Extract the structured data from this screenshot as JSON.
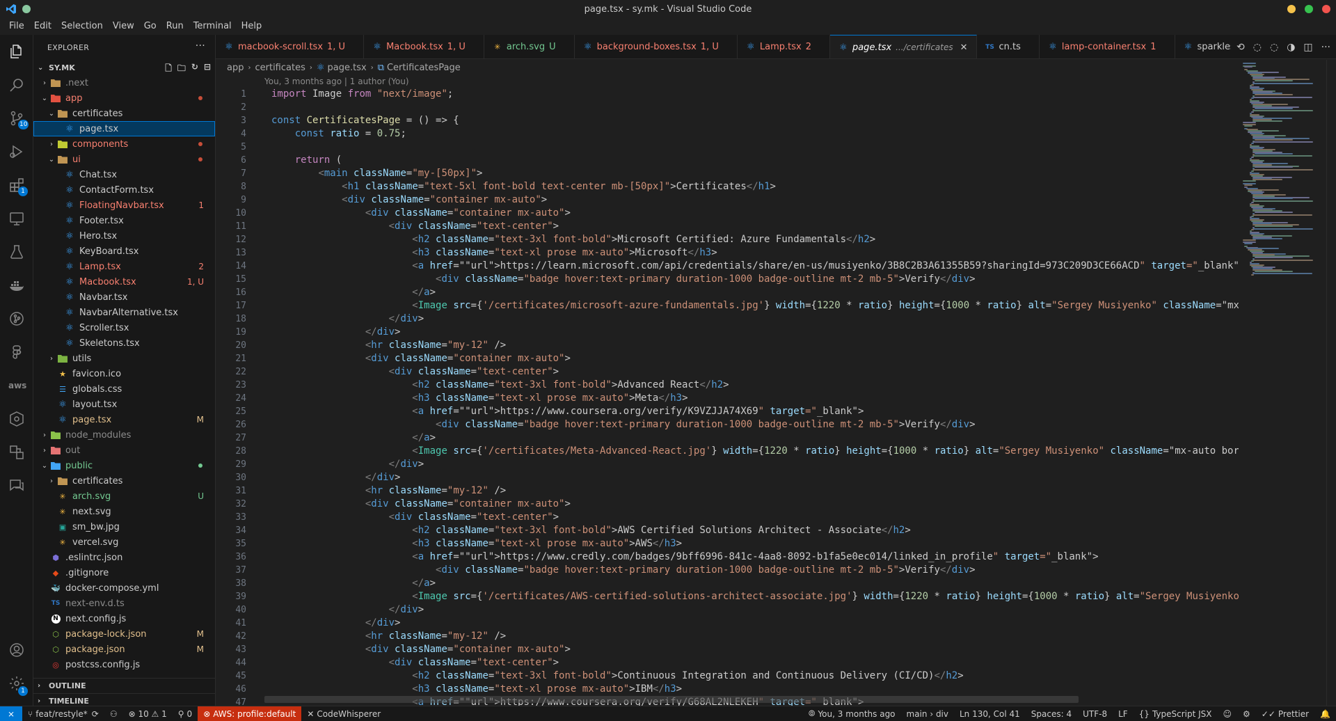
{
  "window": {
    "title": "page.tsx - sy.mk - Visual Studio Code"
  },
  "menu": [
    "File",
    "Edit",
    "Selection",
    "View",
    "Go",
    "Run",
    "Terminal",
    "Help"
  ],
  "activity": {
    "source_control_badge": "10",
    "extensions_badge": "1",
    "settings_badge": "1"
  },
  "explorer": {
    "header": "EXPLORER",
    "more": "···",
    "root": "SY.MK",
    "items": [
      {
        "label": ".next",
        "chev": "›",
        "depth": 1,
        "color": "c-dim",
        "icon": "folder",
        "badge": ""
      },
      {
        "label": "app",
        "chev": "⌄",
        "depth": 1,
        "color": "c-err",
        "icon": "folder-app",
        "badge": "",
        "dot": "#c74e39"
      },
      {
        "label": "certificates",
        "chev": "⌄",
        "depth": 2,
        "color": "c-normal",
        "icon": "folder",
        "badge": ""
      },
      {
        "label": "page.tsx",
        "chev": "",
        "depth": 3,
        "color": "c-normal",
        "icon": "react",
        "badge": "",
        "selected": true
      },
      {
        "label": "components",
        "chev": "›",
        "depth": 2,
        "color": "c-err",
        "icon": "folder-comp",
        "badge": "",
        "dot": "#c74e39"
      },
      {
        "label": "ui",
        "chev": "⌄",
        "depth": 2,
        "color": "c-err",
        "icon": "folder",
        "badge": "",
        "dot": "#c74e39"
      },
      {
        "label": "Chat.tsx",
        "chev": "",
        "depth": 3,
        "color": "c-normal",
        "icon": "react",
        "badge": ""
      },
      {
        "label": "ContactForm.tsx",
        "chev": "",
        "depth": 3,
        "color": "c-normal",
        "icon": "react",
        "badge": ""
      },
      {
        "label": "FloatingNavbar.tsx",
        "chev": "",
        "depth": 3,
        "color": "c-err",
        "icon": "react",
        "badge": "1"
      },
      {
        "label": "Footer.tsx",
        "chev": "",
        "depth": 3,
        "color": "c-normal",
        "icon": "react",
        "badge": ""
      },
      {
        "label": "Hero.tsx",
        "chev": "",
        "depth": 3,
        "color": "c-normal",
        "icon": "react",
        "badge": ""
      },
      {
        "label": "KeyBoard.tsx",
        "chev": "",
        "depth": 3,
        "color": "c-normal",
        "icon": "react",
        "badge": ""
      },
      {
        "label": "Lamp.tsx",
        "chev": "",
        "depth": 3,
        "color": "c-err",
        "icon": "react",
        "badge": "2"
      },
      {
        "label": "Macbook.tsx",
        "chev": "",
        "depth": 3,
        "color": "c-err",
        "icon": "react",
        "badge": "1, U"
      },
      {
        "label": "Navbar.tsx",
        "chev": "",
        "depth": 3,
        "color": "c-normal",
        "icon": "react",
        "badge": ""
      },
      {
        "label": "NavbarAlternative.tsx",
        "chev": "",
        "depth": 3,
        "color": "c-normal",
        "icon": "react",
        "badge": ""
      },
      {
        "label": "Scroller.tsx",
        "chev": "",
        "depth": 3,
        "color": "c-normal",
        "icon": "react",
        "badge": ""
      },
      {
        "label": "Skeletons.tsx",
        "chev": "",
        "depth": 3,
        "color": "c-normal",
        "icon": "react",
        "badge": ""
      },
      {
        "label": "utils",
        "chev": "›",
        "depth": 2,
        "color": "c-normal",
        "icon": "folder-utils",
        "badge": ""
      },
      {
        "label": "favicon.ico",
        "chev": "",
        "depth": 2,
        "color": "c-normal",
        "icon": "star",
        "badge": ""
      },
      {
        "label": "globals.css",
        "chev": "",
        "depth": 2,
        "color": "c-normal",
        "icon": "css",
        "badge": ""
      },
      {
        "label": "layout.tsx",
        "chev": "",
        "depth": 2,
        "color": "c-normal",
        "icon": "react",
        "badge": ""
      },
      {
        "label": "page.tsx",
        "chev": "",
        "depth": 2,
        "color": "c-mod",
        "icon": "react",
        "badge": "M"
      },
      {
        "label": "node_modules",
        "chev": "›",
        "depth": 1,
        "color": "c-dim",
        "icon": "folder-node",
        "badge": ""
      },
      {
        "label": "out",
        "chev": "›",
        "depth": 1,
        "color": "c-dim",
        "icon": "folder-out",
        "badge": ""
      },
      {
        "label": "public",
        "chev": "⌄",
        "depth": 1,
        "color": "c-untr",
        "icon": "folder-public",
        "badge": "",
        "dot": "#73c991"
      },
      {
        "label": "certificates",
        "chev": "›",
        "depth": 2,
        "color": "c-normal",
        "icon": "folder",
        "badge": ""
      },
      {
        "label": "arch.svg",
        "chev": "",
        "depth": 2,
        "color": "c-untr",
        "icon": "svg",
        "badge": "U"
      },
      {
        "label": "next.svg",
        "chev": "",
        "depth": 2,
        "color": "c-normal",
        "icon": "svg",
        "badge": ""
      },
      {
        "label": "sm_bw.jpg",
        "chev": "",
        "depth": 2,
        "color": "c-normal",
        "icon": "image",
        "badge": ""
      },
      {
        "label": "vercel.svg",
        "chev": "",
        "depth": 2,
        "color": "c-normal",
        "icon": "svg",
        "badge": ""
      },
      {
        "label": ".eslintrc.json",
        "chev": "",
        "depth": 1,
        "color": "c-normal",
        "icon": "eslint",
        "badge": ""
      },
      {
        "label": ".gitignore",
        "chev": "",
        "depth": 1,
        "color": "c-normal",
        "icon": "git",
        "badge": ""
      },
      {
        "label": "docker-compose.yml",
        "chev": "",
        "depth": 1,
        "color": "c-normal",
        "icon": "docker",
        "badge": ""
      },
      {
        "label": "next-env.d.ts",
        "chev": "",
        "depth": 1,
        "color": "c-dim",
        "icon": "ts",
        "badge": ""
      },
      {
        "label": "next.config.js",
        "chev": "",
        "depth": 1,
        "color": "c-normal",
        "icon": "next",
        "badge": ""
      },
      {
        "label": "package-lock.json",
        "chev": "",
        "depth": 1,
        "color": "c-mod",
        "icon": "npm",
        "badge": "M"
      },
      {
        "label": "package.json",
        "chev": "",
        "depth": 1,
        "color": "c-mod",
        "icon": "npm",
        "badge": "M"
      },
      {
        "label": "postcss.config.js",
        "chev": "",
        "depth": 1,
        "color": "c-normal",
        "icon": "postcss",
        "badge": ""
      }
    ],
    "outline": "OUTLINE",
    "timeline": "TIMELINE"
  },
  "tabs": [
    {
      "label": "macbook-scroll.tsx",
      "status": "1, U",
      "color": "c-err",
      "icon": "react"
    },
    {
      "label": "Macbook.tsx",
      "status": "1, U",
      "color": "c-err",
      "icon": "react"
    },
    {
      "label": "arch.svg",
      "status": "U",
      "color": "c-untr",
      "icon": "svg"
    },
    {
      "label": "background-boxes.tsx",
      "status": "1, U",
      "color": "c-err",
      "icon": "react"
    },
    {
      "label": "Lamp.tsx",
      "status": "2",
      "color": "c-err",
      "icon": "react"
    },
    {
      "label": "page.tsx",
      "status": "",
      "desc": ".../certificates",
      "color": "c-normal",
      "icon": "react",
      "active": true
    },
    {
      "label": "cn.ts",
      "status": "",
      "color": "c-normal",
      "icon": "ts"
    },
    {
      "label": "lamp-container.tsx",
      "status": "1",
      "color": "c-err",
      "icon": "react"
    },
    {
      "label": "sparkles.tsx",
      "status": "",
      "color": "c-normal",
      "icon": "react"
    }
  ],
  "breadcrumb": [
    "app",
    "certificates",
    "page.tsx",
    "CertificatesPage"
  ],
  "blame": "You, 3 months ago | 1 author (You)",
  "code": [
    "import Image from \"next/image\";",
    "",
    "const CertificatesPage = () => {",
    "    const ratio = 0.75;",
    "",
    "    return (",
    "        <main className=\"my-[50px]\">",
    "            <h1 className=\"text-5xl font-bold text-center mb-[50px]\">Certificates</h1>",
    "            <div className=\"container mx-auto\">",
    "                <div className=\"container mx-auto\">",
    "                    <div className=\"text-center\">",
    "                        <h2 className=\"text-3xl font-bold\">Microsoft Certified: Azure Fundamentals</h2>",
    "                        <h3 className=\"text-xl prose mx-auto\">Microsoft</h3>",
    "                        <a href=\"https://learn.microsoft.com/api/credentials/share/en-us/musiyenko/3B8C2B3A61355B59?sharingId=973C209D3CE66ACD\" target=\"_blank\">",
    "                            <div className=\"badge hover:text-primary duration-1000 badge-outline mt-2 mb-5\">Verify</div>",
    "                        </a>",
    "                        <Image src={'/certificates/microsoft-azure-fundamentals.jpg'} width={1220 * ratio} height={1000 * ratio} alt=\"Sergey Musiyenko\" className=\"mx-au",
    "                    </div>",
    "                </div>",
    "                <hr className=\"my-12\" />",
    "                <div className=\"container mx-auto\">",
    "                    <div className=\"text-center\">",
    "                        <h2 className=\"text-3xl font-bold\">Advanced React</h2>",
    "                        <h3 className=\"text-xl prose mx-auto\">Meta</h3>",
    "                        <a href=\"https://www.coursera.org/verify/K9VZJJA74X69\" target=\"_blank\">",
    "                            <div className=\"badge hover:text-primary duration-1000 badge-outline mt-2 mb-5\">Verify</div>",
    "                        </a>",
    "                        <Image src={'/certificates/Meta-Advanced-React.jpg'} width={1220 * ratio} height={1000 * ratio} alt=\"Sergey Musiyenko\" className=\"mx-auto borde",
    "                    </div>",
    "                </div>",
    "                <hr className=\"my-12\" />",
    "                <div className=\"container mx-auto\">",
    "                    <div className=\"text-center\">",
    "                        <h2 className=\"text-3xl font-bold\">AWS Certified Solutions Architect - Associate</h2>",
    "                        <h3 className=\"text-xl prose mx-auto\">AWS</h3>",
    "                        <a href=\"https://www.credly.com/badges/9bff6996-841c-4aa8-8092-b1fa5e0ec014/linked_in_profile\" target=\"_blank\">",
    "                            <div className=\"badge hover:text-primary duration-1000 badge-outline mt-2 mb-5\">Verify</div>",
    "                        </a>",
    "                        <Image src={'/certificates/AWS-certified-solutions-architect-associate.jpg'} width={1220 * ratio} height={1000 * ratio} alt=\"Sergey Musiyenko\" c",
    "                    </div>",
    "                </div>",
    "                <hr className=\"my-12\" />",
    "                <div className=\"container mx-auto\">",
    "                    <div className=\"text-center\">",
    "                        <h2 className=\"text-3xl font-bold\">Continuous Integration and Continuous Delivery (CI/CD)</h2>",
    "                        <h3 className=\"text-xl prose mx-auto\">IBM</h3>",
    "                        <a href=\"https://www.coursera.org/verify/G68AL2NLEKEH\" target=\"_blank\">"
  ],
  "status": {
    "branch": "feat/restyle*",
    "problems": "⊗ 10 ⚠ 1",
    "ports": "0",
    "aws": "AWS: profile:default",
    "codewhisperer": "CodeWhisperer",
    "blame": "You, 3 months ago",
    "crumb": "main › div",
    "position": "Ln 130, Col 41",
    "spaces": "Spaces: 4",
    "encoding": "UTF-8",
    "eol": "LF",
    "language": "TypeScript JSX",
    "prettier": "Prettier"
  }
}
